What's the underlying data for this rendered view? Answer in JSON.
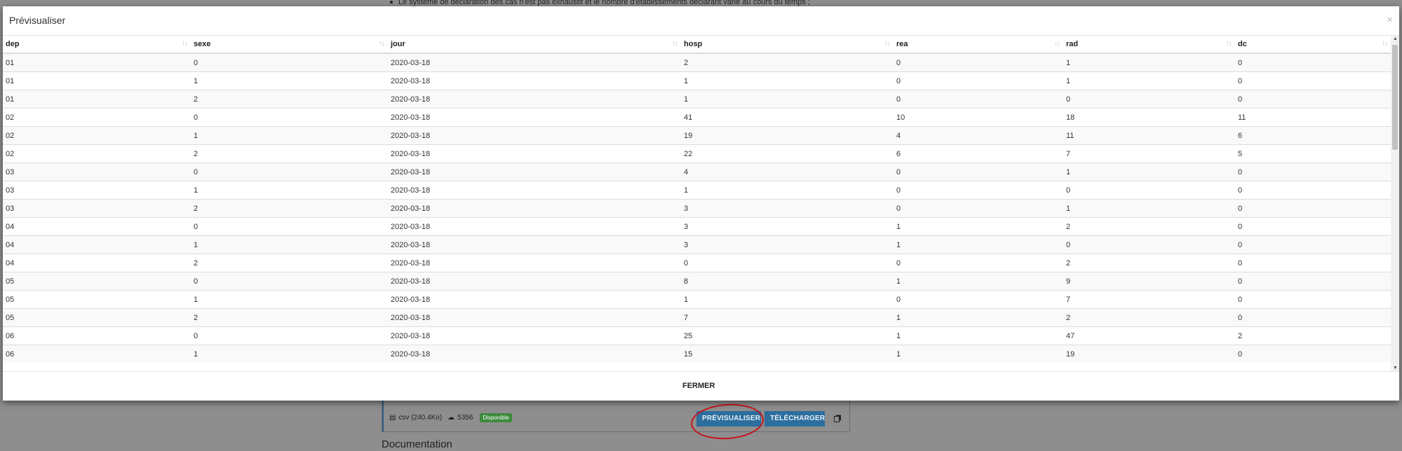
{
  "background": {
    "note": "Le système de déclaration des cas n'est pas exhaustif et le nombre d'établissements déclarant varie au cours du temps ;",
    "resource": {
      "format": "csv (240.4Ko)",
      "downloads": "5356",
      "status": "Disponible",
      "preview_label": "PRÉVISUALISER",
      "download_label": "TÉLÉCHARGER"
    },
    "documentation_heading": "Documentation"
  },
  "modal": {
    "title": "Prévisualiser",
    "close_symbol": "×",
    "close_button_label": "FERMER",
    "table": {
      "columns": [
        "dep",
        "sexe",
        "jour",
        "hosp",
        "rea",
        "rad",
        "dc"
      ],
      "rows": [
        [
          "01",
          "0",
          "2020-03-18",
          "2",
          "0",
          "1",
          "0"
        ],
        [
          "01",
          "1",
          "2020-03-18",
          "1",
          "0",
          "1",
          "0"
        ],
        [
          "01",
          "2",
          "2020-03-18",
          "1",
          "0",
          "0",
          "0"
        ],
        [
          "02",
          "0",
          "2020-03-18",
          "41",
          "10",
          "18",
          "11"
        ],
        [
          "02",
          "1",
          "2020-03-18",
          "19",
          "4",
          "11",
          "6"
        ],
        [
          "02",
          "2",
          "2020-03-18",
          "22",
          "6",
          "7",
          "5"
        ],
        [
          "03",
          "0",
          "2020-03-18",
          "4",
          "0",
          "1",
          "0"
        ],
        [
          "03",
          "1",
          "2020-03-18",
          "1",
          "0",
          "0",
          "0"
        ],
        [
          "03",
          "2",
          "2020-03-18",
          "3",
          "0",
          "1",
          "0"
        ],
        [
          "04",
          "0",
          "2020-03-18",
          "3",
          "1",
          "2",
          "0"
        ],
        [
          "04",
          "1",
          "2020-03-18",
          "3",
          "1",
          "0",
          "0"
        ],
        [
          "04",
          "2",
          "2020-03-18",
          "0",
          "0",
          "2",
          "0"
        ],
        [
          "05",
          "0",
          "2020-03-18",
          "8",
          "1",
          "9",
          "0"
        ],
        [
          "05",
          "1",
          "2020-03-18",
          "1",
          "0",
          "7",
          "0"
        ],
        [
          "05",
          "2",
          "2020-03-18",
          "7",
          "1",
          "2",
          "0"
        ],
        [
          "06",
          "0",
          "2020-03-18",
          "25",
          "1",
          "47",
          "2"
        ],
        [
          "06",
          "1",
          "2020-03-18",
          "15",
          "1",
          "19",
          "0"
        ]
      ]
    }
  },
  "colors": {
    "overlay": "#8e8e8e",
    "primary_button": "#2c6e9e",
    "badge_green": "#3d8a3d",
    "annotation_red": "#c8141a"
  }
}
